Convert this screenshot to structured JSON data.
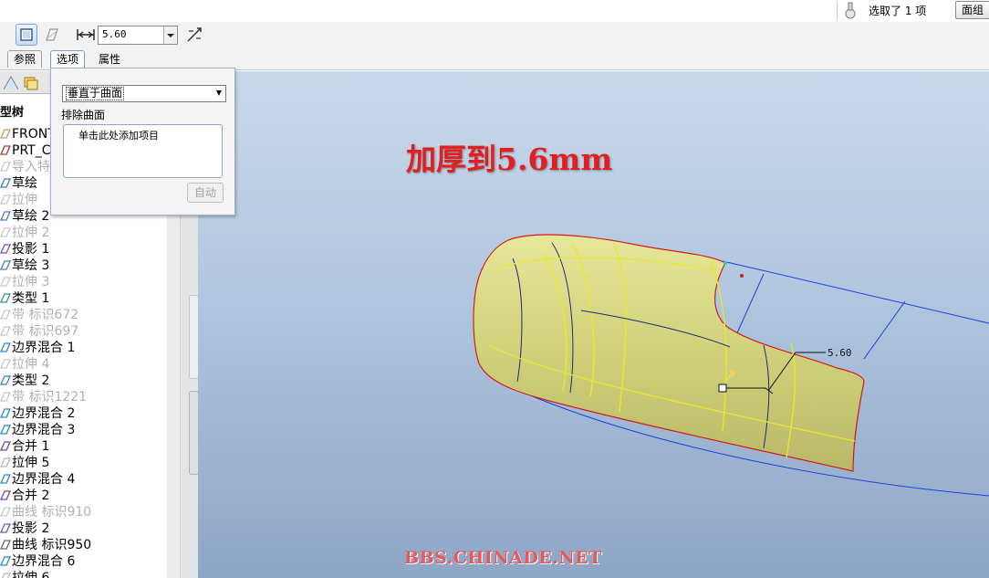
{
  "status": {
    "selection_text": "选取了 1 项",
    "filter_label": "面组"
  },
  "dashboard": {
    "thickness_value": "5.60",
    "tabs": [
      "参照",
      "选项",
      "属性"
    ],
    "active_tab": "选项"
  },
  "options_panel": {
    "orientation_value": "垂直于曲面",
    "exclude_label": "排除曲面",
    "exclude_placeholder": "单击此处添加项目",
    "auto_button": "自动"
  },
  "tree": {
    "header": "型树",
    "items": [
      {
        "label": "FRONT",
        "state": "normal",
        "icon": "datum-plane-icon"
      },
      {
        "label": "PRT_C",
        "state": "normal",
        "icon": "coordinate-system-icon"
      },
      {
        "label": "导入特",
        "state": "dim",
        "icon": "import-feature-icon"
      },
      {
        "label": "草绘",
        "state": "normal",
        "icon": "sketch-icon"
      },
      {
        "label": "拉伸",
        "state": "dim",
        "icon": "extrude-icon"
      },
      {
        "label": "草绘 2",
        "state": "normal",
        "icon": "sketch-icon"
      },
      {
        "label": "拉伸 2",
        "state": "dim",
        "icon": "extrude-icon"
      },
      {
        "label": "投影 1",
        "state": "normal",
        "icon": "projection-icon"
      },
      {
        "label": "草绘 3",
        "state": "normal",
        "icon": "sketch-icon"
      },
      {
        "label": "拉伸 3",
        "state": "dim",
        "icon": "extrude-icon"
      },
      {
        "label": "类型 1",
        "state": "normal",
        "icon": "type-icon"
      },
      {
        "label": "带 标识672",
        "state": "dim",
        "icon": "band-icon"
      },
      {
        "label": "带 标识697",
        "state": "dim",
        "icon": "band-icon"
      },
      {
        "label": "边界混合 1",
        "state": "normal",
        "icon": "boundary-blend-icon"
      },
      {
        "label": "拉伸 4",
        "state": "dim",
        "icon": "extrude-icon"
      },
      {
        "label": "类型 2",
        "state": "normal",
        "icon": "type-icon"
      },
      {
        "label": "带 标识1221",
        "state": "dim",
        "icon": "band-icon"
      },
      {
        "label": "边界混合 2",
        "state": "normal",
        "icon": "boundary-blend-icon"
      },
      {
        "label": "边界混合 3",
        "state": "normal",
        "icon": "boundary-blend-icon"
      },
      {
        "label": "合并 1",
        "state": "normal",
        "icon": "merge-icon"
      },
      {
        "label": "拉伸 5",
        "state": "normal",
        "icon": "extrude-icon"
      },
      {
        "label": "边界混合 4",
        "state": "normal",
        "icon": "boundary-blend-icon"
      },
      {
        "label": "合并 2",
        "state": "normal",
        "icon": "merge-icon"
      },
      {
        "label": "曲线 标识910",
        "state": "dim",
        "icon": "curve-icon"
      },
      {
        "label": "投影 2",
        "state": "normal",
        "icon": "projection-icon"
      },
      {
        "label": "曲线 标识950",
        "state": "normal",
        "icon": "curve-icon"
      },
      {
        "label": "边界混合 6",
        "state": "normal",
        "icon": "boundary-blend-icon"
      },
      {
        "label": "拉伸 6",
        "state": "normal",
        "icon": "extrude-icon"
      }
    ]
  },
  "viewport": {
    "overlay_title": "加厚到5.6mm",
    "dimension_label": "5.60",
    "watermark": "BBS.CHINADE.NET"
  }
}
